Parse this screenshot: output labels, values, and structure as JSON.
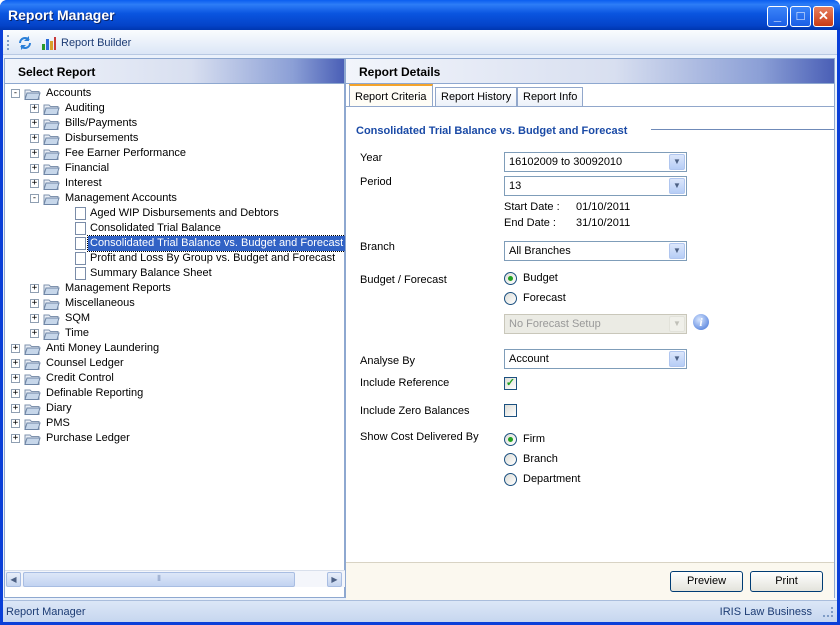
{
  "window": {
    "title": "Report Manager"
  },
  "toolbar": {
    "report_builder": "Report Builder"
  },
  "left": {
    "header": "Select Report"
  },
  "tree": [
    {
      "depth": 0,
      "type": "folder",
      "state": "-",
      "label": "Accounts"
    },
    {
      "depth": 1,
      "type": "folder",
      "state": "+",
      "label": "Auditing"
    },
    {
      "depth": 1,
      "type": "folder",
      "state": "+",
      "label": "Bills/Payments"
    },
    {
      "depth": 1,
      "type": "folder",
      "state": "+",
      "label": "Disbursements"
    },
    {
      "depth": 1,
      "type": "folder",
      "state": "+",
      "label": "Fee Earner Performance"
    },
    {
      "depth": 1,
      "type": "folder",
      "state": "+",
      "label": "Financial"
    },
    {
      "depth": 1,
      "type": "folder",
      "state": "+",
      "label": "Interest"
    },
    {
      "depth": 1,
      "type": "folder",
      "state": "-",
      "label": "Management Accounts"
    },
    {
      "depth": 2,
      "type": "doc",
      "label": "Aged WIP Disbursements and Debtors"
    },
    {
      "depth": 2,
      "type": "doc",
      "label": "Consolidated Trial Balance"
    },
    {
      "depth": 2,
      "type": "doc",
      "label": "Consolidated Trial Balance vs. Budget and Forecast",
      "selected": true
    },
    {
      "depth": 2,
      "type": "doc",
      "label": "Profit and Loss By Group vs. Budget and Forecast"
    },
    {
      "depth": 2,
      "type": "doc",
      "label": "Summary Balance Sheet"
    },
    {
      "depth": 1,
      "type": "folder",
      "state": "+",
      "label": "Management Reports"
    },
    {
      "depth": 1,
      "type": "folder",
      "state": "+",
      "label": "Miscellaneous"
    },
    {
      "depth": 1,
      "type": "folder",
      "state": "+",
      "label": "SQM"
    },
    {
      "depth": 1,
      "type": "folder",
      "state": "+",
      "label": "Time"
    },
    {
      "depth": 0,
      "type": "folder",
      "state": "+",
      "label": "Anti Money Laundering"
    },
    {
      "depth": 0,
      "type": "folder",
      "state": "+",
      "label": "Counsel Ledger"
    },
    {
      "depth": 0,
      "type": "folder",
      "state": "+",
      "label": "Credit Control"
    },
    {
      "depth": 0,
      "type": "folder",
      "state": "+",
      "label": "Definable Reporting"
    },
    {
      "depth": 0,
      "type": "folder",
      "state": "+",
      "label": "Diary"
    },
    {
      "depth": 0,
      "type": "folder",
      "state": "+",
      "label": "PMS"
    },
    {
      "depth": 0,
      "type": "folder",
      "state": "+",
      "label": "Purchase Ledger"
    }
  ],
  "right": {
    "header": "Report Details"
  },
  "tabs": [
    "Report Criteria",
    "Report History",
    "Report Info"
  ],
  "criteria": {
    "section_title": "Consolidated Trial Balance vs. Budget and Forecast",
    "year_label": "Year",
    "year_value": "16102009 to 30092010",
    "period_label": "Period",
    "period_value": "13",
    "start_date_label": "Start Date  :",
    "start_date": "01/10/2011",
    "end_date_label": "End Date  :",
    "end_date": "31/10/2011",
    "branch_label": "Branch",
    "branch_value": "All Branches",
    "budget_label": "Budget / Forecast",
    "budget_option": "Budget",
    "forecast_option": "Forecast",
    "forecast_setup": "No Forecast Setup",
    "analyse_label": "Analyse By",
    "analyse_value": "Account",
    "include_ref_label": "Include Reference",
    "include_zero_label": "Include Zero Balances",
    "cost_label": "Show Cost Delivered By",
    "cost_firm": "Firm",
    "cost_branch": "Branch",
    "cost_department": "Department"
  },
  "buttons": {
    "preview": "Preview",
    "print": "Print"
  },
  "status": {
    "left": "Report Manager",
    "right": "IRIS Law Business"
  },
  "colors": {
    "title_bar": "#0a55e0",
    "selection": "#3162c5",
    "section_title": "#1a4aa6",
    "radio_dot": "#21a121"
  }
}
